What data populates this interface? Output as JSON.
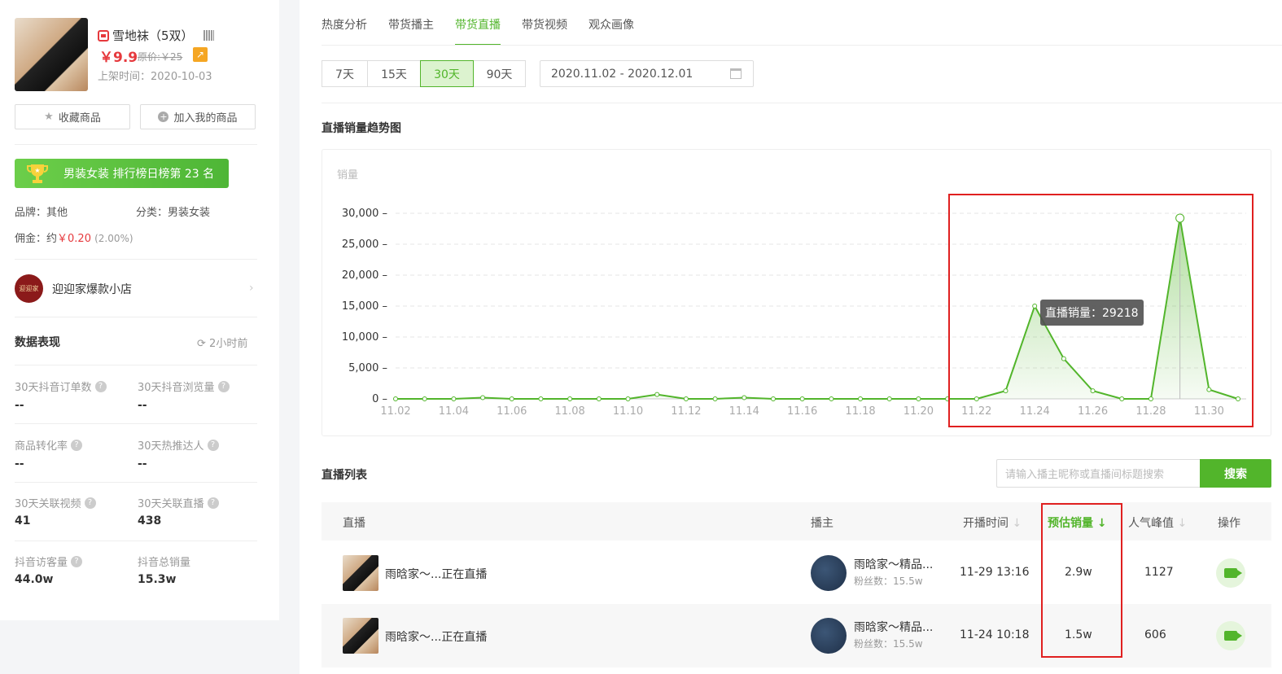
{
  "product": {
    "name": "雪地袜（5双）",
    "price": "￥9.9",
    "original_price": "原价:￥25",
    "listed": "上架时间：2020-10-03",
    "favorite_label": "收藏商品",
    "add_label": "加入我的商品",
    "rank_text": "男装女装 排行榜日榜第 23 名",
    "brand": "品牌：其他",
    "category": "分类：男装女装",
    "commission_label": "佣金：约",
    "commission_value": "￥0.20",
    "commission_rate": "(2.00%)"
  },
  "shop": {
    "logo_text": "迎迎家",
    "name": "迎迎家爆款小店"
  },
  "stats": {
    "title": "数据表现",
    "updated": "2小时前",
    "items": [
      {
        "label": "30天抖音订单数",
        "value": "--"
      },
      {
        "label": "30天抖音浏览量",
        "value": "--"
      },
      {
        "label": "商品转化率",
        "value": "--"
      },
      {
        "label": "30天热推达人",
        "value": "--"
      },
      {
        "label": "30天关联视频",
        "value": "41"
      },
      {
        "label": "30天关联直播",
        "value": "438"
      },
      {
        "label": "抖音访客量",
        "value": "44.0w"
      },
      {
        "label": "抖音总销量",
        "value": "15.3w"
      }
    ]
  },
  "tabs": [
    "热度分析",
    "带货播主",
    "带货直播",
    "带货视频",
    "观众画像"
  ],
  "active_tab": 2,
  "days": [
    "7天",
    "15天",
    "30天",
    "90天"
  ],
  "active_day": 2,
  "date_range": "2020.11.02 - 2020.12.01",
  "chart_title": "直播销量趋势图",
  "tooltip": "直播销量：29218",
  "chart_data": {
    "type": "area",
    "ylabel": "销量",
    "ylim": [
      0,
      30000
    ],
    "yticks": [
      "30,000",
      "25,000",
      "20,000",
      "15,000",
      "10,000",
      "5,000",
      "0"
    ],
    "x_tick_labels": [
      "11.02",
      "11.04",
      "11.06",
      "11.08",
      "11.10",
      "11.12",
      "11.14",
      "11.16",
      "11.18",
      "11.20",
      "11.22",
      "11.24",
      "11.26",
      "11.28",
      "11.30"
    ],
    "x": [
      "11.02",
      "11.03",
      "11.04",
      "11.05",
      "11.06",
      "11.07",
      "11.08",
      "11.09",
      "11.10",
      "11.11",
      "11.12",
      "11.13",
      "11.14",
      "11.15",
      "11.16",
      "11.17",
      "11.18",
      "11.19",
      "11.20",
      "11.21",
      "11.22",
      "11.23",
      "11.24",
      "11.25",
      "11.26",
      "11.27",
      "11.28",
      "11.29",
      "11.30",
      "12.01"
    ],
    "values": [
      0,
      0,
      0,
      200,
      0,
      0,
      0,
      0,
      0,
      700,
      0,
      0,
      200,
      0,
      0,
      0,
      0,
      0,
      0,
      0,
      0,
      1300,
      15000,
      6500,
      1300,
      0,
      0,
      29218,
      1500,
      0
    ],
    "color": "#52b52b",
    "grid": true
  },
  "list": {
    "title": "直播列表",
    "search_placeholder": "请输入播主昵称或直播间标题搜索",
    "search_button": "搜索",
    "headers": {
      "live": "直播",
      "host": "播主",
      "start": "开播时间",
      "sales": "预估销量",
      "peak": "人气峰值",
      "op": "操作"
    },
    "rows": [
      {
        "title": "雨晗家～...正在直播",
        "host": "雨晗家～精品...",
        "fans": "粉丝数：15.5w",
        "start": "11-29 13:16",
        "sales": "2.9w",
        "peak": "1127"
      },
      {
        "title": "雨晗家～...正在直播",
        "host": "雨晗家～精品...",
        "fans": "粉丝数：15.5w",
        "start": "11-24 10:18",
        "sales": "1.5w",
        "peak": "606"
      }
    ]
  }
}
